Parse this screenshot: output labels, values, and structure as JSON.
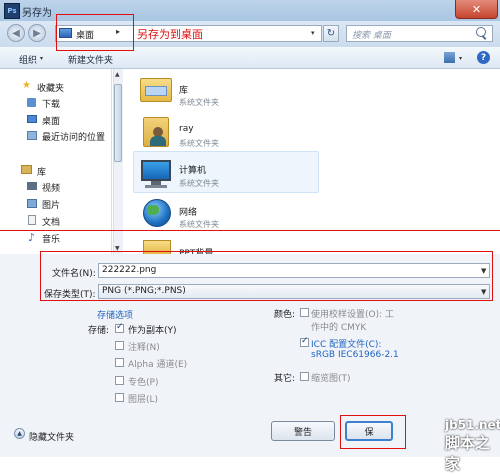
{
  "window": {
    "title": "另存为",
    "app_icon": "Ps",
    "close": "✕"
  },
  "nav": {
    "back": "◀",
    "forward": "▶",
    "address": "桌面",
    "address_sep": "▸",
    "address_drop": "▾",
    "refresh": "↻",
    "search_placeholder": "搜索 桌面"
  },
  "toolbar": {
    "organize": "组织",
    "new_folder": "新建文件夹",
    "organize_arrow": "▾",
    "view_arrow": "▾",
    "help": "?"
  },
  "sidebar": {
    "favorites": "收藏夹",
    "items": [
      "下载",
      "桌面",
      "最近访问的位置"
    ],
    "library": "库",
    "lib_items": [
      "视频",
      "图片",
      "文档",
      "音乐"
    ]
  },
  "files": [
    {
      "name": "库",
      "sub": "系统文件夹"
    },
    {
      "name": "ray",
      "sub": "系统文件夹"
    },
    {
      "name": "计算机",
      "sub": "系统文件夹"
    },
    {
      "name": "网络",
      "sub": "系统文件夹"
    },
    {
      "name": "PPT背景",
      "sub": ""
    }
  ],
  "form": {
    "filename_label": "文件名(N):",
    "filename_value": "222222.png",
    "type_label": "保存类型(T):",
    "type_value": "PNG (*.PNG;*.PNS)",
    "save_options": "存储选项",
    "save_label": "存储:",
    "as_copy": "作为副本(Y)",
    "notes": "注释(N)",
    "alpha": "Alpha 通道(E)",
    "spot": "专色(P)",
    "layers": "图层(L)",
    "color_label": "颜色:",
    "proof_line1": "使用校样设置(O): 工",
    "proof_line2": "作中的 CMYK",
    "icc_line1": "ICC 配置文件(C):",
    "icc_line2": "sRGB IEC61966-2.1",
    "other_label": "其它:",
    "thumbnail": "缩览图(T)",
    "warning_button": "警告",
    "save_button": "保",
    "hide_folders": "隐藏文件夹",
    "hide_arrow": "▲"
  },
  "annotation": {
    "text": "另存为到桌面"
  },
  "watermark": {
    "line1": "jb51.net",
    "line2": "脚本之家"
  }
}
